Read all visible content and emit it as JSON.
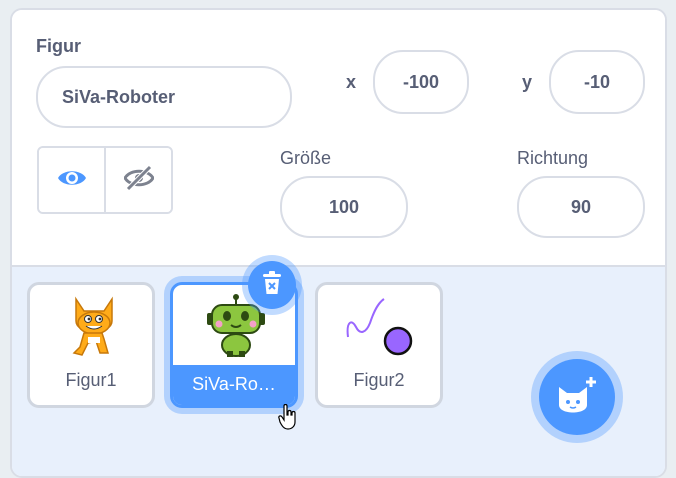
{
  "sprite_info": {
    "sprite_label": "Figur",
    "sprite_name": "SiVa-Roboter",
    "x_label": "x",
    "x_value": "-100",
    "y_label": "y",
    "y_value": "-10",
    "size_label": "Größe",
    "size_value": "100",
    "direction_label": "Richtung",
    "direction_value": "90",
    "show_icon": "eye-icon",
    "hide_icon": "eye-slash-icon"
  },
  "sprite_list": {
    "items": [
      {
        "name": "Figur1",
        "thumbnail": "scratch-cat",
        "selected": false
      },
      {
        "name": "SiVa-Ro…",
        "thumbnail": "green-robot",
        "selected": true
      },
      {
        "name": "Figur2",
        "thumbnail": "purple-line-dot",
        "selected": false
      }
    ],
    "delete_icon": "trash-icon",
    "add_icon": "cat-plus-icon"
  },
  "colors": {
    "accent": "#4c97ff",
    "text": "#575e75",
    "border": "#d9dde6",
    "sprite_pane_bg": "#e8f0fc"
  }
}
